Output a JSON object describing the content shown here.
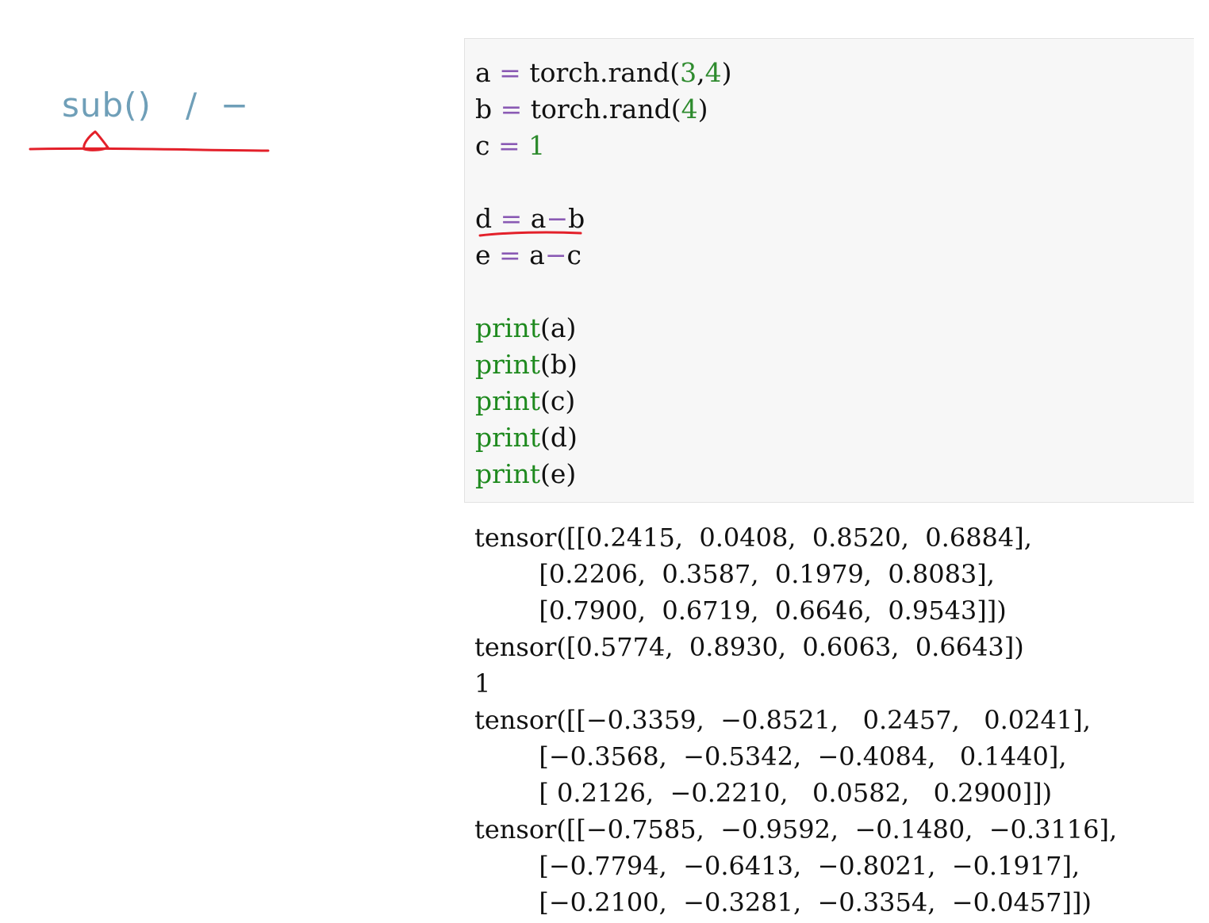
{
  "annotation": {
    "text": "sub()   /  −",
    "ink_color": "#e3202a"
  },
  "code_cell": {
    "lines": [
      {
        "parts": [
          {
            "t": "a ",
            "c": ""
          },
          {
            "t": "=",
            "c": "op"
          },
          {
            "t": " torch.rand(",
            "c": ""
          },
          {
            "t": "3",
            "c": "num"
          },
          {
            "t": ",",
            "c": ""
          },
          {
            "t": "4",
            "c": "num"
          },
          {
            "t": ")",
            "c": ""
          }
        ]
      },
      {
        "parts": [
          {
            "t": "b ",
            "c": ""
          },
          {
            "t": "=",
            "c": "op"
          },
          {
            "t": " torch.rand(",
            "c": ""
          },
          {
            "t": "4",
            "c": "num"
          },
          {
            "t": ")",
            "c": ""
          }
        ]
      },
      {
        "parts": [
          {
            "t": "c ",
            "c": ""
          },
          {
            "t": "=",
            "c": "op"
          },
          {
            "t": " ",
            "c": ""
          },
          {
            "t": "1",
            "c": "num"
          }
        ]
      },
      {
        "parts": []
      },
      {
        "parts": [
          {
            "t": "d ",
            "c": ""
          },
          {
            "t": "=",
            "c": "op"
          },
          {
            "t": " a",
            "c": ""
          },
          {
            "t": "−",
            "c": "op"
          },
          {
            "t": "b",
            "c": ""
          }
        ]
      },
      {
        "parts": [
          {
            "t": "e ",
            "c": ""
          },
          {
            "t": "=",
            "c": "op"
          },
          {
            "t": " a",
            "c": ""
          },
          {
            "t": "−",
            "c": "op"
          },
          {
            "t": "c",
            "c": ""
          }
        ]
      },
      {
        "parts": []
      },
      {
        "parts": [
          {
            "t": "print",
            "c": "kw"
          },
          {
            "t": "(a)",
            "c": ""
          }
        ]
      },
      {
        "parts": [
          {
            "t": "print",
            "c": "kw"
          },
          {
            "t": "(b)",
            "c": ""
          }
        ]
      },
      {
        "parts": [
          {
            "t": "print",
            "c": "kw"
          },
          {
            "t": "(c)",
            "c": ""
          }
        ]
      },
      {
        "parts": [
          {
            "t": "print",
            "c": "kw"
          },
          {
            "t": "(d)",
            "c": ""
          }
        ]
      },
      {
        "parts": [
          {
            "t": "print",
            "c": "kw"
          },
          {
            "t": "(e)",
            "c": ""
          }
        ]
      }
    ]
  },
  "output": {
    "lines": [
      "tensor([[0.2415,  0.0408,  0.8520,  0.6884],",
      "        [0.2206,  0.3587,  0.1979,  0.8083],",
      "        [0.7900,  0.6719,  0.6646,  0.9543]])",
      "tensor([0.5774,  0.8930,  0.6063,  0.6643])",
      "1",
      "tensor([[−0.3359,  −0.8521,   0.2457,   0.0241],",
      "        [−0.3568,  −0.5342,  −0.4084,   0.1440],",
      "        [ 0.2126,  −0.2210,   0.0582,   0.2900]])",
      "tensor([[−0.7585,  −0.9592,  −0.1480,  −0.3116],",
      "        [−0.7794,  −0.6413,  −0.8021,  −0.1917],",
      "        [−0.2100,  −0.3281,  −0.3354,  −0.0457]])"
    ]
  }
}
